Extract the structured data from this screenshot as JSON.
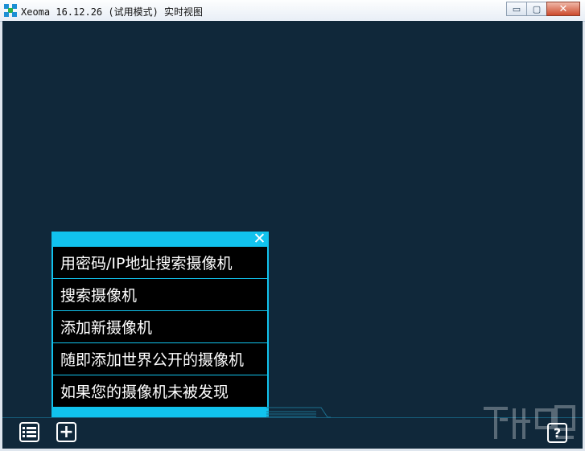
{
  "window": {
    "title": "Xeoma 16.12.26 (试用模式) 实时视图",
    "minimize_symbol": "▭",
    "maximize_symbol": "▢",
    "close_symbol": "✕"
  },
  "menu": {
    "close_symbol": "✕",
    "items": [
      {
        "label": "用密码/IP地址搜索摄像机"
      },
      {
        "label": "搜索摄像机"
      },
      {
        "label": "添加新摄像机"
      },
      {
        "label": "随即添加世界公开的摄像机"
      },
      {
        "label": "如果您的摄像机未被发现"
      }
    ]
  },
  "toolbar": {
    "list_icon": "list-icon",
    "add_symbol": "+",
    "help_symbol": "?"
  },
  "colors": {
    "background": "#10283a",
    "accent": "#11c3ee",
    "menu_item_bg": "#000000"
  }
}
